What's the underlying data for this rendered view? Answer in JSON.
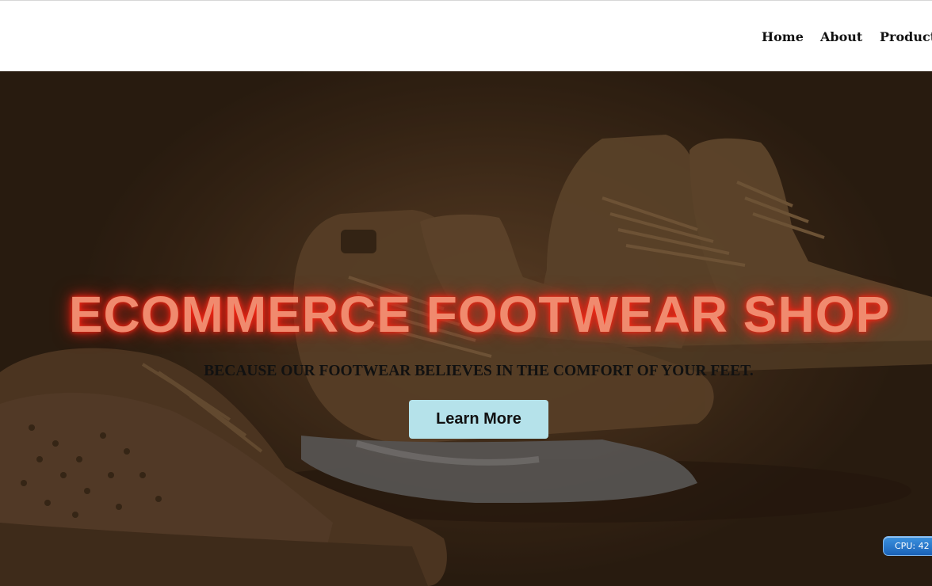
{
  "nav": {
    "links": [
      "Home",
      "About",
      "Product"
    ]
  },
  "hero": {
    "title": "ECOMMERCE FOOTWEAR SHOP",
    "subtitle": "BECAUSE OUR FOOTWEAR BELIEVES IN THE COMFORT OF YOUR FEET.",
    "button_label": "Learn More"
  },
  "cpu_widget": {
    "text": "CPU: 42"
  },
  "colors": {
    "hero_background": "#4e3620",
    "title_glow": "#ff2a14",
    "title_text": "#f08a6e",
    "button_background": "#b5e2ea"
  }
}
